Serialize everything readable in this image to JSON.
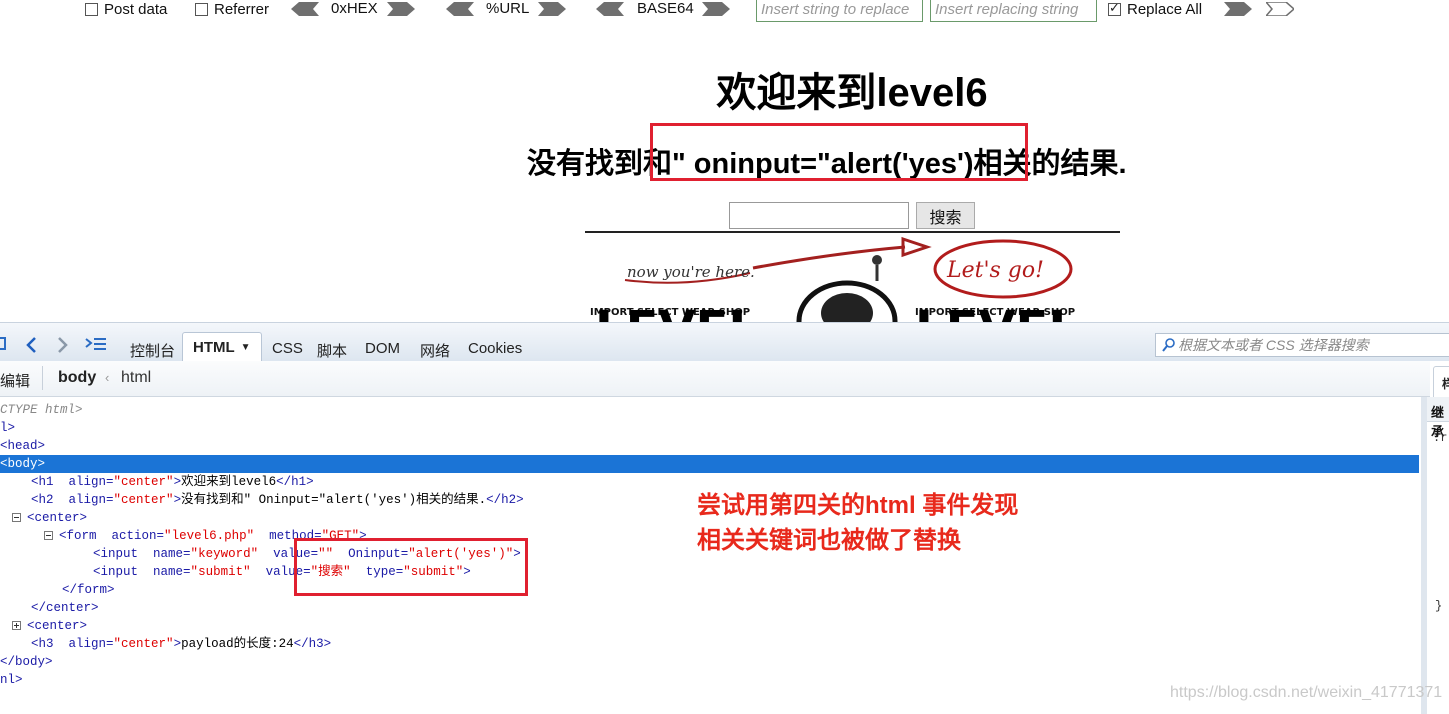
{
  "hackbar": {
    "post_data_label": "Post data",
    "post_data_checked": false,
    "referrer_label": "Referrer",
    "referrer_checked": false,
    "hex_label": "0xHEX",
    "url_label": "%URL",
    "base64_label": "BASE64",
    "find_placeholder": "Insert string to replace",
    "replace_placeholder": "Insert replacing string",
    "replace_all_label": "Replace All",
    "replace_all_checked": true
  },
  "page": {
    "h1": "欢迎来到level6",
    "h2": "没有找到和\" oninput=\"alert('yes')相关的结果.",
    "search_button": "搜索",
    "banner": {
      "now_text": "now you're here.",
      "lets_go": "Let's go!",
      "shop_left": "IMPORT SELECT WEAR SHOP",
      "shop_right": "IMPORT SELECT WEAR SHOP",
      "big_text": "LEVEL"
    }
  },
  "devtools": {
    "tabs": {
      "console": "控制台",
      "html": "HTML",
      "css": "CSS",
      "script": "脚本",
      "dom": "DOM",
      "net": "网络",
      "cookies": "Cookies"
    },
    "search_placeholder": "根据文本或者 CSS 选择器搜索",
    "breadcrumb": {
      "edit": "编辑",
      "body": "body",
      "html": "html"
    },
    "side_tab": "样",
    "side_head": "继承",
    "side_line1": ":r",
    "side_line2": "}",
    "tree": {
      "doctype": "CTYPE html>",
      "html_open": "l>",
      "head": "<head>",
      "body_open": "<body>",
      "h1_text": "欢迎来到level6",
      "h2_text": "没有找到和\" Oninput=\"alert('yes')相关的结果.",
      "form_action": "level6.php",
      "form_method": "GET",
      "input1_name": "keyword",
      "input1_value": "\"",
      "input1_extra_attr": "Oninput",
      "input1_extra_val": "alert('yes')",
      "input2_name": "submit",
      "input2_value": "搜索",
      "input2_type": "submit",
      "h3_text": "payload的长度:24",
      "body_close": "</body>",
      "html_close": "nl>"
    }
  },
  "annotation": {
    "line1": "尝试用第四关的html 事件发现",
    "line2": "相关关键词也被做了替换"
  },
  "watermark": "https://blog.csdn.net/weixin_41771371"
}
